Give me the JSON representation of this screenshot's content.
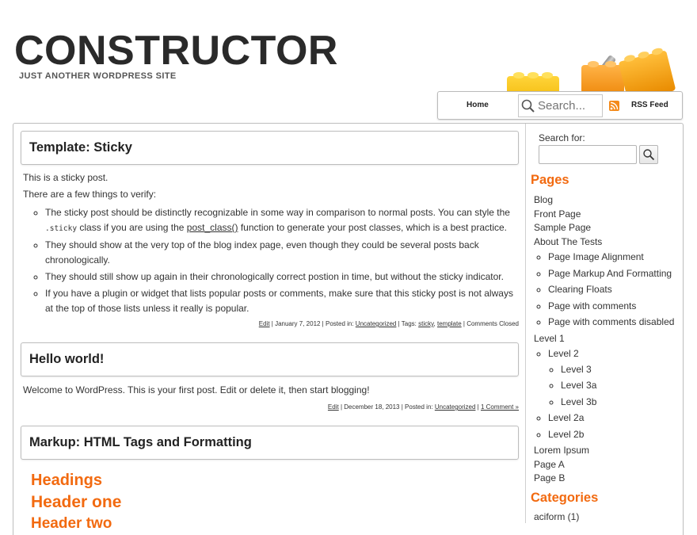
{
  "site": {
    "title": "CONSTRUCTOR",
    "description": "JUST ANOTHER WORDPRESS SITE"
  },
  "nav": {
    "home": "Home",
    "search_placeholder": "Search...",
    "rss": "RSS Feed"
  },
  "posts": [
    {
      "title": "Template: Sticky",
      "intro1": "This is a sticky post.",
      "intro2": "There are a few things to verify:",
      "bullets": {
        "b1_pre": "The sticky post should be distinctly recognizable in some way in comparison to normal posts. You can style the ",
        "b1_code": ".sticky",
        "b1_mid": " class if you are using the ",
        "b1_link": "post_class()",
        "b1_post": " function to generate your post classes, which is a best practice.",
        "b2": "They should show at the very top of the blog index page, even though they could be several posts back chronologically.",
        "b3": "They should still show up again in their chronologically correct postion in time, but without the sticky indicator.",
        "b4": "If you have a plugin or widget that lists popular posts or comments, make sure that this sticky post is not always at the top of those lists unless it really is popular."
      },
      "meta": {
        "edit": "Edit",
        "date": " | January 7, 2012 | Posted in: ",
        "category": "Uncategorized",
        "tags_label": " | Tags: ",
        "tag1": "sticky",
        "sep": ", ",
        "tag2": "template",
        "comments": " | Comments Closed"
      }
    },
    {
      "title": "Hello world!",
      "body": "Welcome to WordPress. This is your first post. Edit or delete it, then start blogging!",
      "meta": {
        "edit": "Edit",
        "date": " | December 18, 2013 | Posted in: ",
        "category": "Uncategorized",
        "sep": " | ",
        "comments": "1 Comment »"
      }
    },
    {
      "title": "Markup: HTML Tags and Formatting",
      "headings": [
        "Headings",
        "Header one",
        "Header two"
      ]
    }
  ],
  "sidebar": {
    "search_label": "Search for:",
    "pages_title": "Pages",
    "pages": {
      "blog": "Blog",
      "front": "Front Page",
      "sample": "Sample Page",
      "about": "About The Tests",
      "about_children": [
        "Page Image Alignment",
        "Page Markup And Formatting",
        "Clearing Floats",
        "Page with comments",
        "Page with comments disabled"
      ],
      "level1": "Level 1",
      "level2": "Level 2",
      "level3": "Level 3",
      "level3a": "Level 3a",
      "level3b": "Level 3b",
      "level2a": "Level 2a",
      "level2b": "Level 2b",
      "lorem": "Lorem Ipsum",
      "pagea": "Page A",
      "pageb": "Page B"
    },
    "categories_title": "Categories",
    "categories": [
      "aciform (1)"
    ]
  },
  "colors": {
    "accent": "#f26a10",
    "rss": "#f48a1a"
  }
}
